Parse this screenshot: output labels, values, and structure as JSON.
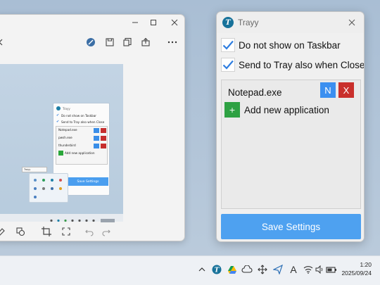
{
  "trayy": {
    "title": "Trayy",
    "logo_letter": "T",
    "options": [
      {
        "label": "Do not show on Taskbar",
        "checked": true
      },
      {
        "label": "Send to Tray also when Close",
        "checked": true
      }
    ],
    "apps": [
      {
        "name": "Notepad.exe",
        "n_label": "N",
        "x_label": "X"
      }
    ],
    "add_label": "Add new application",
    "add_icon": "+",
    "save_label": "Save Settings"
  },
  "screenshot_preview": {
    "title": "Trayy",
    "options": [
      "Do not show on Taskbar",
      "Send to Tray also when Close"
    ],
    "apps": [
      "Notepad.exe",
      "pwsh.exe",
      "thunderbird"
    ],
    "add_label": "Add new application",
    "save_label": "Save Settings",
    "tooltip": "Trayy"
  },
  "taskbar": {
    "time": "1:20",
    "date": "2025/09/24",
    "ime_label": "A"
  },
  "colors": {
    "accent_blue": "#4ea1f0",
    "n_button": "#3b8ff0",
    "x_button": "#c9302c",
    "add_button": "#2ea143",
    "check_blue": "#2f7ee0"
  }
}
